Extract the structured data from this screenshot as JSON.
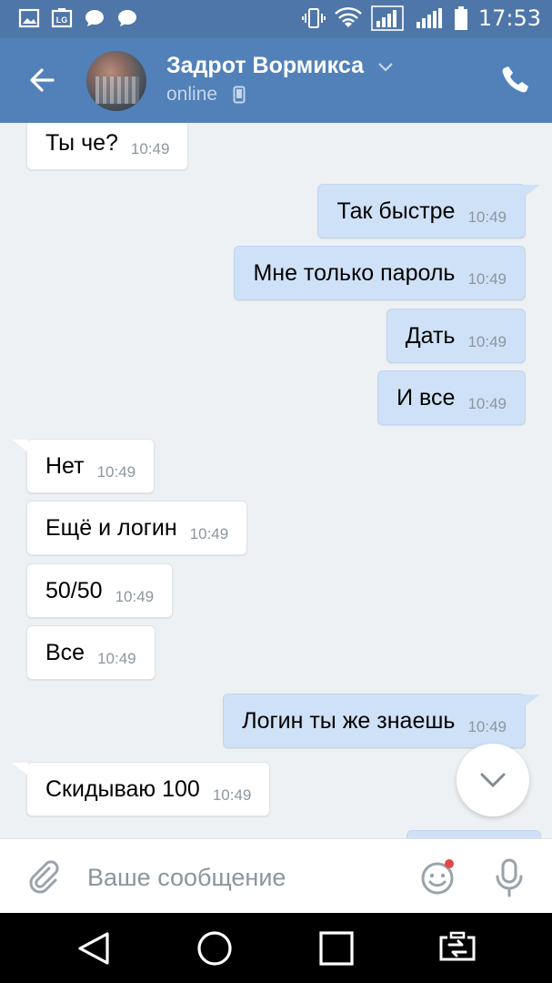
{
  "status_bar": {
    "time": "17:53",
    "left_icons": [
      "gallery-icon",
      "lg-icon",
      "chat-bubble-icon",
      "chat-bubble-icon"
    ],
    "right_icons": [
      "vibrate-icon",
      "wifi-icon",
      "signal-icon",
      "signal-icon",
      "battery-icon"
    ],
    "lg_badge": "LG"
  },
  "header": {
    "title": "Задрот Вормикса",
    "status": "online",
    "accent_color": "#5181b8",
    "icons": [
      "back-arrow-icon",
      "chevron-down-icon",
      "mobile-icon",
      "phone-icon"
    ]
  },
  "messages": [
    {
      "dir": "in",
      "text": "Ты че?",
      "time": "10:49"
    },
    {
      "dir": "out",
      "text": "Так быстре",
      "time": "10:49"
    },
    {
      "dir": "out",
      "text": "Мне только пароль",
      "time": "10:49"
    },
    {
      "dir": "out",
      "text": "Дать",
      "time": "10:49"
    },
    {
      "dir": "out",
      "text": "И все",
      "time": "10:49"
    },
    {
      "dir": "in",
      "text": "Нет",
      "time": "10:49"
    },
    {
      "dir": "in",
      "text": "Ещё и логин",
      "time": "10:49"
    },
    {
      "dir": "in",
      "text": "50/50",
      "time": "10:49"
    },
    {
      "dir": "in",
      "text": "Все",
      "time": "10:49"
    },
    {
      "dir": "out",
      "text": "Логин ты же знаешь",
      "time": "10:49"
    },
    {
      "dir": "in",
      "text": "Скидываю 100",
      "time": "10:49"
    }
  ],
  "composer": {
    "placeholder": "Ваше сообщение",
    "icons": [
      "paperclip-icon",
      "emoji-icon",
      "microphone-icon"
    ]
  },
  "nav": {
    "icons": [
      "back-triangle-icon",
      "home-circle-icon",
      "recents-square-icon",
      "dual-window-icon"
    ]
  }
}
